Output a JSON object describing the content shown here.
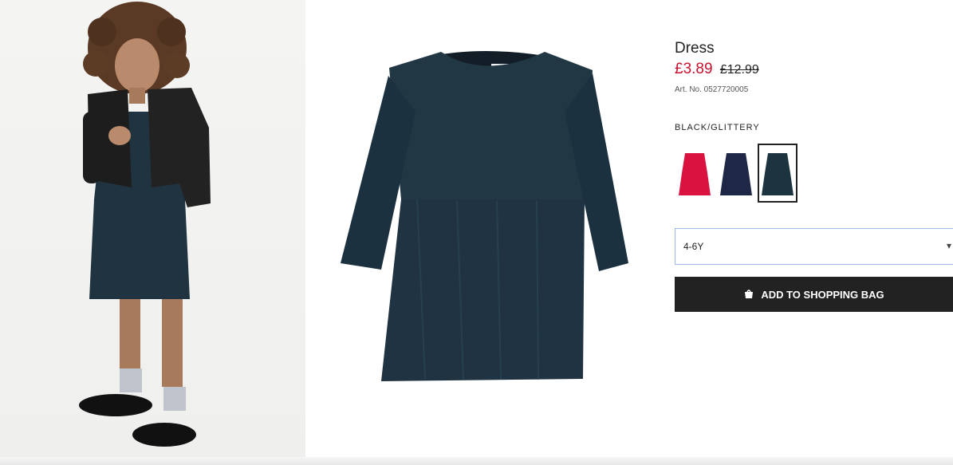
{
  "product": {
    "title": "Dress",
    "price_sale": "£3.89",
    "price_original": "£12.99",
    "article_number": "Art. No. 0527720005",
    "selected_color": "BLACK/GLITTERY",
    "swatches": [
      {
        "name": "red",
        "color": "#d9123f"
      },
      {
        "name": "navy",
        "color": "#1f2747"
      },
      {
        "name": "black-glittery",
        "color": "#1b3440"
      }
    ],
    "size_value": "4-6Y",
    "add_to_bag_label": "ADD TO SHOPPING BAG"
  },
  "colors": {
    "sale_red": "#c8102e",
    "button_bg": "#222222",
    "select_border": "#9fb8e6"
  },
  "icons": {
    "bag": "shopping-bag-icon",
    "chevron": "chevron-down-icon"
  }
}
